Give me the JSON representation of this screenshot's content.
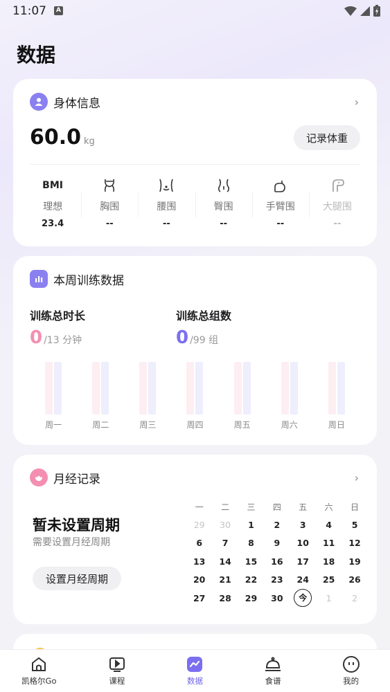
{
  "status_bar": {
    "time": "11:07",
    "notification_badge": "A"
  },
  "page": {
    "title": "数据"
  },
  "body_info": {
    "title": "身体信息",
    "weight_value": "60.0",
    "weight_unit": "kg",
    "record_button": "记录体重",
    "metrics": [
      {
        "icon_text": "BMI",
        "label": "理想",
        "value": "23.4"
      },
      {
        "icon": "chest-icon",
        "label": "胸围",
        "value": "--"
      },
      {
        "icon": "waist-icon",
        "label": "腰围",
        "value": "--"
      },
      {
        "icon": "hip-icon",
        "label": "臀围",
        "value": "--"
      },
      {
        "icon": "arm-icon",
        "label": "手臂围",
        "value": "--"
      },
      {
        "icon": "thigh-icon",
        "label": "大腿围",
        "value": "--"
      }
    ]
  },
  "weekly_training": {
    "title": "本周训练数据",
    "duration": {
      "label": "训练总时长",
      "value": "0",
      "rest": "/13 分钟",
      "color": "#f48fb1"
    },
    "sets": {
      "label": "训练总组数",
      "value": "0",
      "rest": "/99 组",
      "color": "#7b6ff0"
    },
    "days": [
      "周一",
      "周二",
      "周三",
      "周四",
      "周五",
      "周六",
      "周日"
    ]
  },
  "period": {
    "title": "月经记录",
    "status_title": "暂未设置周期",
    "status_subtitle": "需要设置月经周期",
    "set_button": "设置月经周期",
    "weekdays": [
      "一",
      "二",
      "三",
      "四",
      "五",
      "六",
      "日"
    ],
    "weeks": [
      [
        "29",
        "30",
        "1",
        "2",
        "3",
        "4",
        "5"
      ],
      [
        "6",
        "7",
        "8",
        "9",
        "10",
        "11",
        "12"
      ],
      [
        "13",
        "14",
        "15",
        "16",
        "17",
        "18",
        "19"
      ],
      [
        "20",
        "21",
        "22",
        "23",
        "24",
        "25",
        "26"
      ],
      [
        "27",
        "28",
        "29",
        "30",
        "今",
        "1",
        "2"
      ]
    ]
  },
  "nav": [
    {
      "label": "凯格尔Go",
      "icon": "home-icon",
      "active": false
    },
    {
      "label": "课程",
      "icon": "play-icon",
      "active": false
    },
    {
      "label": "数据",
      "icon": "chart-icon",
      "active": true
    },
    {
      "label": "食谱",
      "icon": "cloche-icon",
      "active": false
    },
    {
      "label": "我的",
      "icon": "face-icon",
      "active": false
    }
  ],
  "colors": {
    "accent": "#6f66e9",
    "pink": "#f48fb1",
    "period_icon": "#f48fb1",
    "user_icon": "#8b80f0"
  }
}
